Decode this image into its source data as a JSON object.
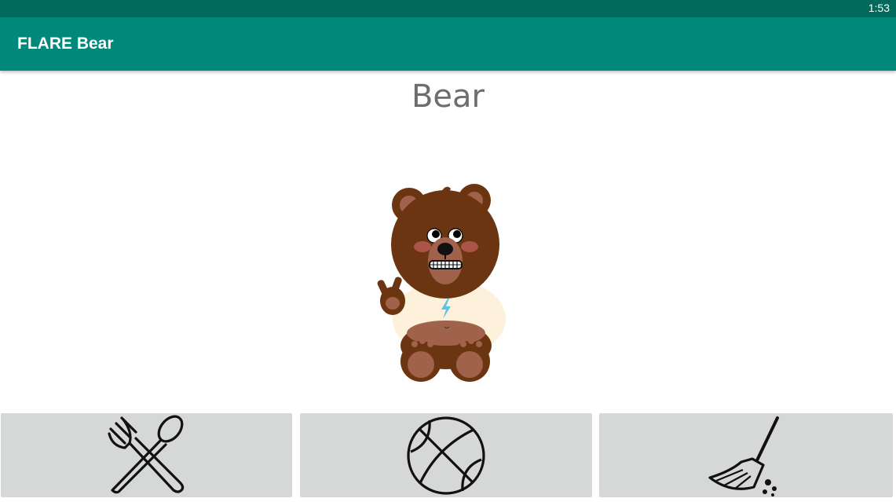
{
  "status_bar": {
    "time": "1:53"
  },
  "app_bar": {
    "title": "FLARE Bear"
  },
  "pet": {
    "name": "Bear"
  },
  "actions": [
    {
      "id": "feed",
      "icon": "fork-spoon-icon"
    },
    {
      "id": "play",
      "icon": "basketball-icon"
    },
    {
      "id": "clean",
      "icon": "broom-icon"
    }
  ],
  "colors": {
    "status_bar": "#00695c",
    "app_bar": "#00897b",
    "button_bg": "#d6d7d7",
    "bear_fur": "#6b3511",
    "bear_shirt": "#fdf1dc"
  }
}
